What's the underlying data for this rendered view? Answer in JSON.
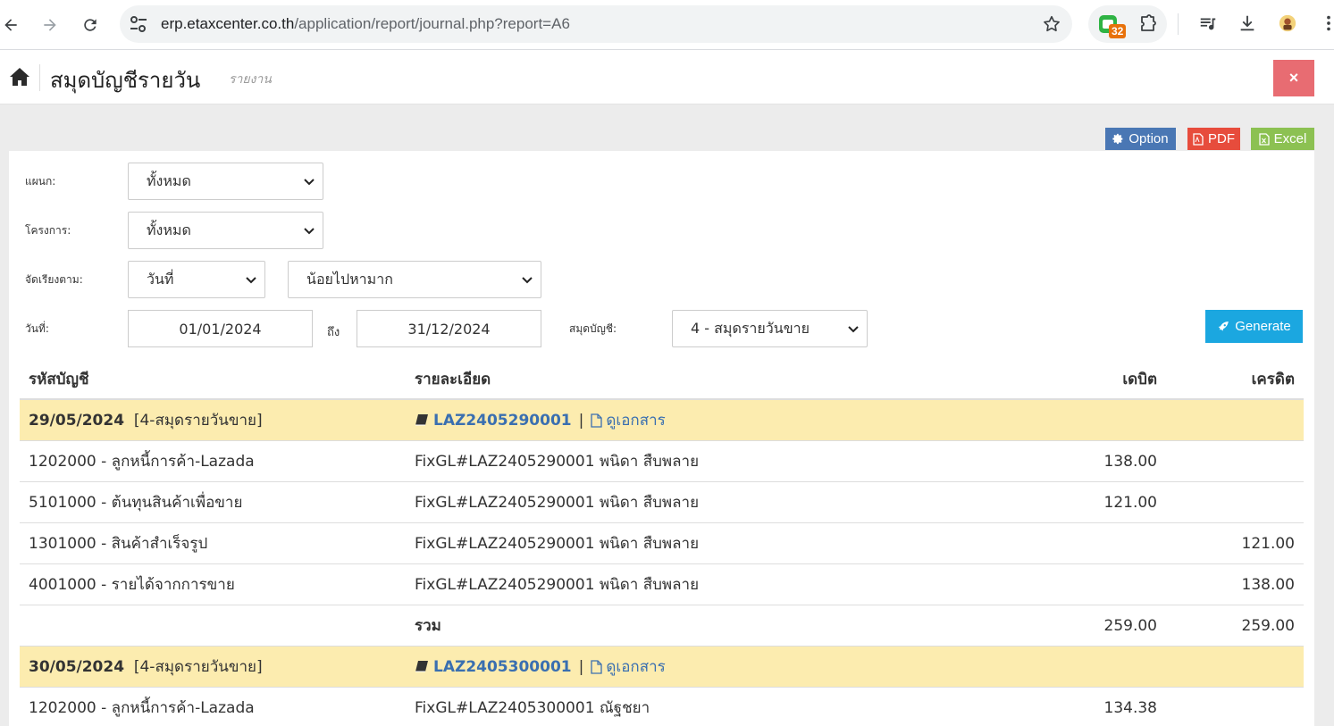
{
  "browser": {
    "url_host": "erp.etaxcenter.co.th",
    "url_path": "/application/report/journal.php?report=A6",
    "extension_badge": "32"
  },
  "header": {
    "title": "สมุดบัญชีรายวัน",
    "subtitle": "รายงาน",
    "close_label": "×"
  },
  "actions": {
    "option": "Option",
    "pdf": "PDF",
    "excel": "Excel"
  },
  "filters": {
    "department_label": "แผนก:",
    "department_value": "ทั้งหมด",
    "project_label": "โครงการ:",
    "project_value": "ทั้งหมด",
    "sort_label": "จัดเรียงตาม:",
    "sort_field": "วันที่",
    "sort_order": "น้อยไปหามาก",
    "date_label": "วันที่:",
    "date_from": "01/01/2024",
    "to_label": "ถึง",
    "date_to": "31/12/2024",
    "journal_label": "สมุดบัญชี:",
    "journal_value": "4 - สมุดรายวันขาย",
    "generate": "Generate"
  },
  "table": {
    "headers": {
      "account": "รหัสบัญชี",
      "description": "รายละเอียด",
      "debit": "เดบิต",
      "credit": "เครดิต"
    },
    "group1": {
      "date": "29/05/2024",
      "journal": "[4-สมุดรายวันขาย]",
      "doc": "LAZ2405290001",
      "separator": "|",
      "view": "ดูเอกสาร"
    },
    "rows1": [
      {
        "account": "1202000 - ลูกหนี้การค้า-Lazada",
        "description": "FixGL#LAZ2405290001 พนิดา สืบพลาย",
        "debit": "138.00",
        "credit": ""
      },
      {
        "account": "5101000 - ต้นทุนสินค้าเพื่อขาย",
        "description": "FixGL#LAZ2405290001 พนิดา สืบพลาย",
        "debit": "121.00",
        "credit": ""
      },
      {
        "account": "1301000 - สินค้าสำเร็จรูป",
        "description": "FixGL#LAZ2405290001 พนิดา สืบพลาย",
        "debit": "",
        "credit": "121.00"
      },
      {
        "account": "4001000 - รายได้จากการขาย",
        "description": "FixGL#LAZ2405290001 พนิดา สืบพลาย",
        "debit": "",
        "credit": "138.00"
      }
    ],
    "total1": {
      "label": "รวม",
      "debit": "259.00",
      "credit": "259.00"
    },
    "group2": {
      "date": "30/05/2024",
      "journal": "[4-สมุดรายวันขาย]",
      "doc": "LAZ2405300001",
      "separator": "|",
      "view": "ดูเอกสาร"
    },
    "rows2": [
      {
        "account": "1202000 - ลูกหนี้การค้า-Lazada",
        "description": "FixGL#LAZ2405300001 ณัฐชยา",
        "debit": "134.38",
        "credit": ""
      }
    ]
  }
}
